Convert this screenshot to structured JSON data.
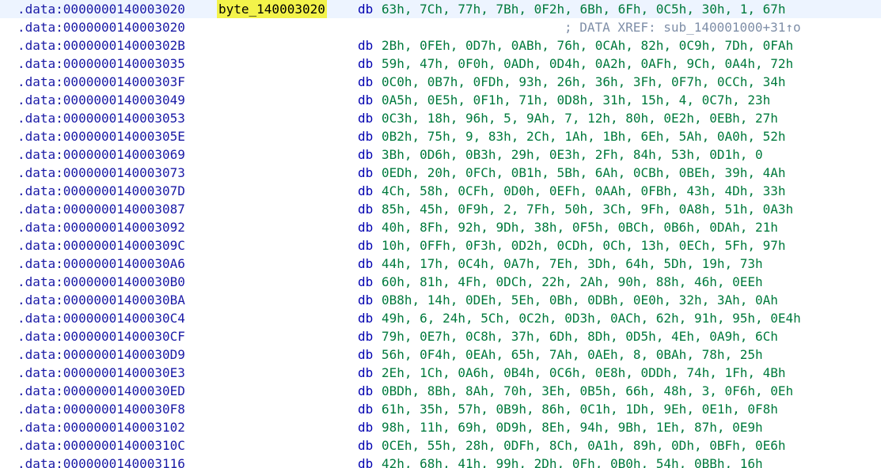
{
  "listing": {
    "highlight_color": "#f3f34a",
    "address_color": "#1a1aa6",
    "operand_color": "#007a3d",
    "comment_color": "#7f8fa8",
    "lines": [
      {
        "addr": ".data:0000000140003020",
        "label": "byte_140003020",
        "mnem": "db",
        "ops": "63h, 7Ch, 77h, 7Bh, 0F2h, 6Bh, 6Fh, 0C5h, 30h, 1, 67h",
        "comment": ""
      },
      {
        "addr": ".data:0000000140003020",
        "label": "",
        "mnem": "",
        "ops": "",
        "comment": "; DATA XREF: sub_140001000+31↑o"
      },
      {
        "addr": ".data:000000014000302B",
        "label": "",
        "mnem": "db",
        "ops": "2Bh, 0FEh, 0D7h, 0ABh, 76h, 0CAh, 82h, 0C9h, 7Dh, 0FAh",
        "comment": ""
      },
      {
        "addr": ".data:0000000140003035",
        "label": "",
        "mnem": "db",
        "ops": "59h, 47h, 0F0h, 0ADh, 0D4h, 0A2h, 0AFh, 9Ch, 0A4h, 72h",
        "comment": ""
      },
      {
        "addr": ".data:000000014000303F",
        "label": "",
        "mnem": "db",
        "ops": "0C0h, 0B7h, 0FDh, 93h, 26h, 36h, 3Fh, 0F7h, 0CCh, 34h",
        "comment": ""
      },
      {
        "addr": ".data:0000000140003049",
        "label": "",
        "mnem": "db",
        "ops": "0A5h, 0E5h, 0F1h, 71h, 0D8h, 31h, 15h, 4, 0C7h, 23h",
        "comment": ""
      },
      {
        "addr": ".data:0000000140003053",
        "label": "",
        "mnem": "db",
        "ops": "0C3h, 18h, 96h, 5, 9Ah, 7, 12h, 80h, 0E2h, 0EBh, 27h",
        "comment": ""
      },
      {
        "addr": ".data:000000014000305E",
        "label": "",
        "mnem": "db",
        "ops": "0B2h, 75h, 9, 83h, 2Ch, 1Ah, 1Bh, 6Eh, 5Ah, 0A0h, 52h",
        "comment": ""
      },
      {
        "addr": ".data:0000000140003069",
        "label": "",
        "mnem": "db",
        "ops": "3Bh, 0D6h, 0B3h, 29h, 0E3h, 2Fh, 84h, 53h, 0D1h, 0",
        "comment": ""
      },
      {
        "addr": ".data:0000000140003073",
        "label": "",
        "mnem": "db",
        "ops": "0EDh, 20h, 0FCh, 0B1h, 5Bh, 6Ah, 0CBh, 0BEh, 39h, 4Ah",
        "comment": ""
      },
      {
        "addr": ".data:000000014000307D",
        "label": "",
        "mnem": "db",
        "ops": "4Ch, 58h, 0CFh, 0D0h, 0EFh, 0AAh, 0FBh, 43h, 4Dh, 33h",
        "comment": ""
      },
      {
        "addr": ".data:0000000140003087",
        "label": "",
        "mnem": "db",
        "ops": "85h, 45h, 0F9h, 2, 7Fh, 50h, 3Ch, 9Fh, 0A8h, 51h, 0A3h",
        "comment": ""
      },
      {
        "addr": ".data:0000000140003092",
        "label": "",
        "mnem": "db",
        "ops": "40h, 8Fh, 92h, 9Dh, 38h, 0F5h, 0BCh, 0B6h, 0DAh, 21h",
        "comment": ""
      },
      {
        "addr": ".data:000000014000309C",
        "label": "",
        "mnem": "db",
        "ops": "10h, 0FFh, 0F3h, 0D2h, 0CDh, 0Ch, 13h, 0ECh, 5Fh, 97h",
        "comment": ""
      },
      {
        "addr": ".data:00000001400030A6",
        "label": "",
        "mnem": "db",
        "ops": "44h, 17h, 0C4h, 0A7h, 7Eh, 3Dh, 64h, 5Dh, 19h, 73h",
        "comment": ""
      },
      {
        "addr": ".data:00000001400030B0",
        "label": "",
        "mnem": "db",
        "ops": "60h, 81h, 4Fh, 0DCh, 22h, 2Ah, 90h, 88h, 46h, 0EEh",
        "comment": ""
      },
      {
        "addr": ".data:00000001400030BA",
        "label": "",
        "mnem": "db",
        "ops": "0B8h, 14h, 0DEh, 5Eh, 0Bh, 0DBh, 0E0h, 32h, 3Ah, 0Ah",
        "comment": ""
      },
      {
        "addr": ".data:00000001400030C4",
        "label": "",
        "mnem": "db",
        "ops": "49h, 6, 24h, 5Ch, 0C2h, 0D3h, 0ACh, 62h, 91h, 95h, 0E4h",
        "comment": ""
      },
      {
        "addr": ".data:00000001400030CF",
        "label": "",
        "mnem": "db",
        "ops": "79h, 0E7h, 0C8h, 37h, 6Dh, 8Dh, 0D5h, 4Eh, 0A9h, 6Ch",
        "comment": ""
      },
      {
        "addr": ".data:00000001400030D9",
        "label": "",
        "mnem": "db",
        "ops": "56h, 0F4h, 0EAh, 65h, 7Ah, 0AEh, 8, 0BAh, 78h, 25h",
        "comment": ""
      },
      {
        "addr": ".data:00000001400030E3",
        "label": "",
        "mnem": "db",
        "ops": "2Eh, 1Ch, 0A6h, 0B4h, 0C6h, 0E8h, 0DDh, 74h, 1Fh, 4Bh",
        "comment": ""
      },
      {
        "addr": ".data:00000001400030ED",
        "label": "",
        "mnem": "db",
        "ops": "0BDh, 8Bh, 8Ah, 70h, 3Eh, 0B5h, 66h, 48h, 3, 0F6h, 0Eh",
        "comment": ""
      },
      {
        "addr": ".data:00000001400030F8",
        "label": "",
        "mnem": "db",
        "ops": "61h, 35h, 57h, 0B9h, 86h, 0C1h, 1Dh, 9Eh, 0E1h, 0F8h",
        "comment": ""
      },
      {
        "addr": ".data:0000000140003102",
        "label": "",
        "mnem": "db",
        "ops": "98h, 11h, 69h, 0D9h, 8Eh, 94h, 9Bh, 1Eh, 87h, 0E9h",
        "comment": ""
      },
      {
        "addr": ".data:000000014000310C",
        "label": "",
        "mnem": "db",
        "ops": "0CEh, 55h, 28h, 0DFh, 8Ch, 0A1h, 89h, 0Dh, 0BFh, 0E6h",
        "comment": ""
      },
      {
        "addr": ".data:0000000140003116",
        "label": "",
        "mnem": "db",
        "ops": "42h, 68h, 41h, 99h, 2Dh, 0Fh, 0B0h, 54h, 0BBh, 16h",
        "comment": ""
      }
    ]
  }
}
